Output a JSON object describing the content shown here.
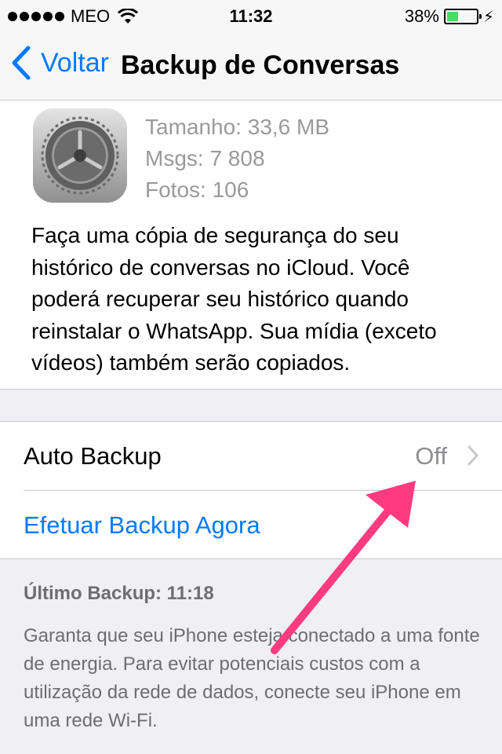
{
  "status": {
    "carrier": "MEO",
    "time": "11:32",
    "battery": "38%",
    "battery_level": 0.38
  },
  "nav": {
    "back_label": "Voltar",
    "title": "Backup de Conversas"
  },
  "info": {
    "size": "Tamanho: 33,6 MB",
    "msgs": "Msgs: 7 808",
    "photos": "Fotos: 106",
    "description": "Faça uma cópia de segurança do seu histórico de conversas no iCloud. Você poderá recuperar seu histórico quando reinstalar o WhatsApp. Sua mídia (exceto vídeos) também serão copiados."
  },
  "options": {
    "auto_backup_label": "Auto Backup",
    "auto_backup_value": "Off",
    "backup_now_label": "Efetuar Backup Agora"
  },
  "footer": {
    "last_backup": "Último Backup: 11:18",
    "note": "Garanta que seu iPhone esteja conectado a uma fonte de energia. Para evitar potenciais custos com a utilização da rede de dados, conecte seu iPhone em uma rede Wi-Fi."
  },
  "colors": {
    "accent": "#007aff",
    "annotation_arrow": "#ff3b7f",
    "battery": "#4cd964"
  }
}
